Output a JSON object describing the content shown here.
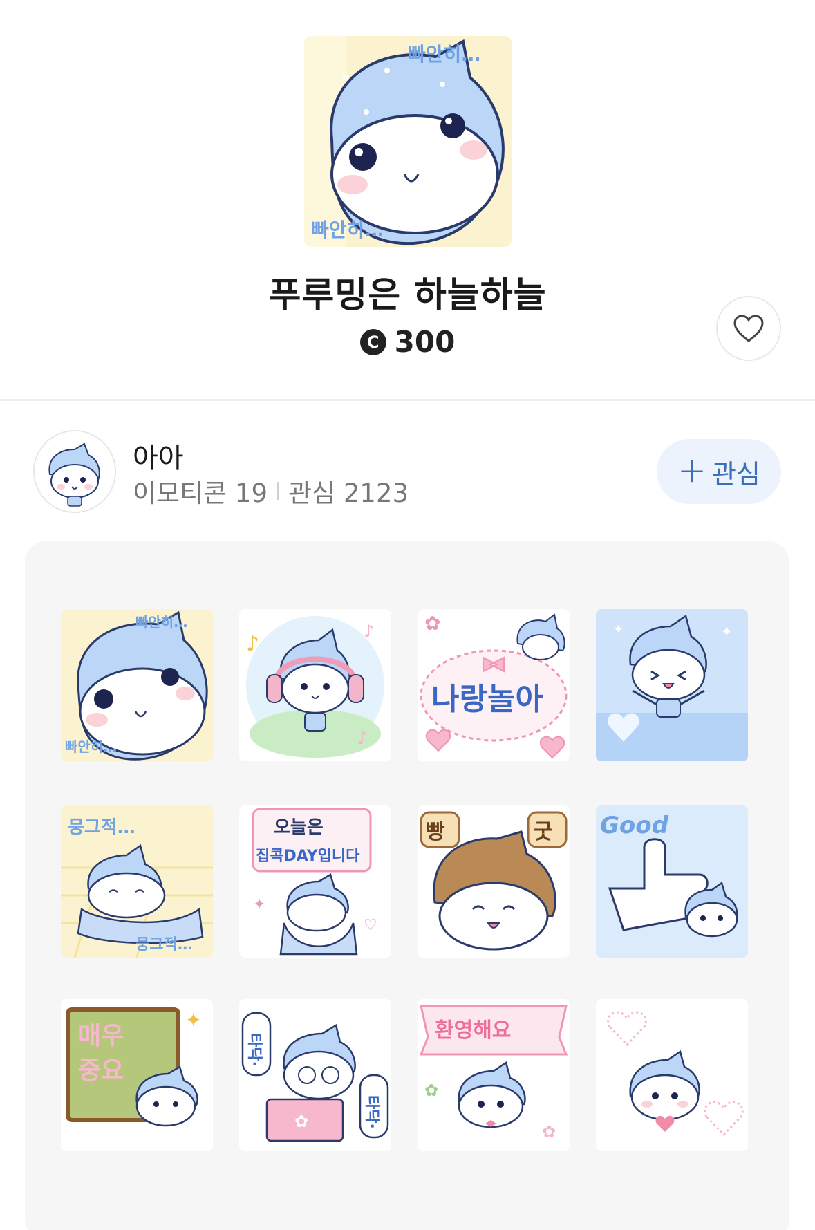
{
  "product": {
    "title": "푸루밍은 하늘하늘",
    "price": "300",
    "coin_symbol": "C",
    "like_icon": "heart-outline-icon"
  },
  "author": {
    "name": "아아",
    "emoticon_count_label": "이모티콘 19",
    "follower_count_label": "관심 2123",
    "follow_button_label": "관심",
    "follow_icon": "plus-icon"
  },
  "stickers": [
    {
      "caption_top": "빠안히…",
      "caption_bottom": "빠안히…",
      "bg": "#fbf3cf"
    },
    {
      "caption_top": "",
      "caption_bottom": "",
      "bg": "#e7f3fb"
    },
    {
      "caption_top": "나랑놀아",
      "caption_bottom": "",
      "bg": "#ffffff"
    },
    {
      "caption_top": "",
      "caption_bottom": "",
      "bg": "#cfe3fb"
    },
    {
      "caption_top": "뭉그적…",
      "caption_bottom": "뭉그적…",
      "bg": "#fbf3cf"
    },
    {
      "caption_top": "오늘은",
      "caption_bottom": "집콕DAY입니다",
      "bg": "#ffffff"
    },
    {
      "caption_top": "빵",
      "caption_bottom": "굿",
      "bg": "#ffffff"
    },
    {
      "caption_top": "Good",
      "caption_bottom": "",
      "bg": "#dcebfb"
    },
    {
      "caption_top": "매우",
      "caption_bottom": "중요",
      "bg": "#ffffff"
    },
    {
      "caption_top": "타닥·",
      "caption_bottom": "타닥·",
      "bg": "#ffffff"
    },
    {
      "caption_top": "환영해요",
      "caption_bottom": "",
      "bg": "#ffffff"
    },
    {
      "caption_top": "",
      "caption_bottom": "",
      "bg": "#ffffff"
    }
  ]
}
